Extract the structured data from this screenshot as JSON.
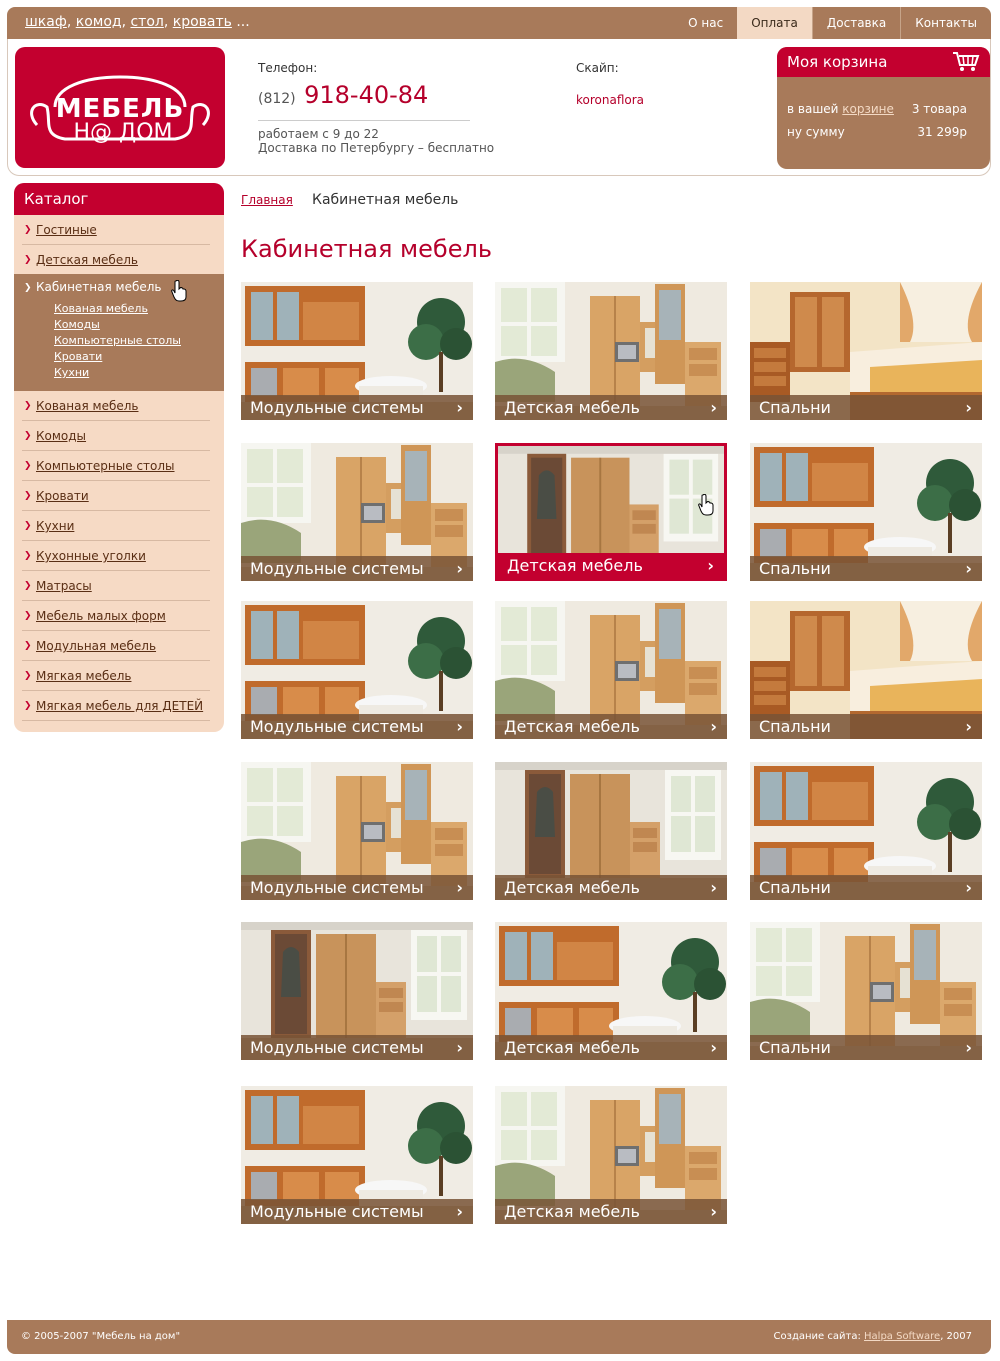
{
  "top": {
    "tags": [
      "шкаф",
      "комод",
      "стол",
      "кровать"
    ],
    "tags_tail": "...",
    "nav": [
      {
        "label": "О нас",
        "active": false
      },
      {
        "label": "Оплата",
        "active": true
      },
      {
        "label": "Доставка",
        "active": false
      },
      {
        "label": "Контакты",
        "active": false
      }
    ]
  },
  "logo": {
    "line1": "МЕБЕЛЬ",
    "line2": "Н@ ДОМ"
  },
  "contacts": {
    "phone_label": "Телефон:",
    "phone_code": "(812)",
    "phone_number": "918-40-84",
    "hours": "работаем с 9 до 22",
    "delivery": "Доставка по Петербургу – бесплатно",
    "skype_label": "Скайп:",
    "skype": "koronaflora"
  },
  "cart": {
    "title": "Моя корзина",
    "line1_prefix": "в вашей ",
    "line1_link": "корзине",
    "items": "3 товара",
    "line2": "ну сумму",
    "sum": "31 299р"
  },
  "sidebar": {
    "title": "Каталог",
    "items_top": [
      "Гостиные",
      "Детская мебель"
    ],
    "active": "Кабинетная мебель",
    "sub": [
      "Кованая мебель",
      "Комоды",
      "Компьютерные столы",
      "Кровати",
      "Кухни"
    ],
    "items_bottom": [
      "Кованая мебель",
      "Комоды",
      "Компьютерные столы",
      "Кровати",
      "Кухни",
      "Кухонные уголки",
      "Матрасы",
      "Мебель малых форм",
      "Модульная мебель",
      "Мягкая мебель",
      "Мягкая мебель для ДЕТЕЙ"
    ]
  },
  "breadcrumb": {
    "home": "Главная",
    "current": "Кабинетная мебель"
  },
  "page_title": "Кабинетная мебель",
  "tiles": [
    {
      "label": "Модульные системы",
      "scene": "kitchen"
    },
    {
      "label": "Детская мебель",
      "scene": "wardrobe"
    },
    {
      "label": "Спальни",
      "scene": "bedroom"
    },
    {
      "label": "Модульные системы",
      "scene": "wardrobe"
    },
    {
      "label": "Детская мебель",
      "scene": "hall",
      "highlight": true
    },
    {
      "label": "Спальни",
      "scene": "kitchen"
    },
    {
      "label": "Модульные системы",
      "scene": "kitchen"
    },
    {
      "label": "Детская мебель",
      "scene": "wardrobe"
    },
    {
      "label": "Спальни",
      "scene": "bedroom"
    },
    {
      "label": "Модульные системы",
      "scene": "wardrobe"
    },
    {
      "label": "Детская мебель",
      "scene": "hall"
    },
    {
      "label": "Спальни",
      "scene": "kitchen"
    },
    {
      "label": "Модульные системы",
      "scene": "hall"
    },
    {
      "label": "Детская мебель",
      "scene": "kitchen"
    },
    {
      "label": "Спальни",
      "scene": "wardrobe"
    },
    {
      "label": "Модульные системы",
      "scene": "kitchen"
    },
    {
      "label": "Детская мебель",
      "scene": "wardrobe"
    }
  ],
  "footer": {
    "copyright": "© 2005-2007 \"Мебель на дом\"",
    "credit_prefix": "Создание сайта: ",
    "credit_link": "Halpa Software",
    "credit_suffix": ", 2007"
  },
  "colors": {
    "brand_red": "#c3002f",
    "brown": "#a87a5a",
    "beige": "#f6dac5"
  }
}
